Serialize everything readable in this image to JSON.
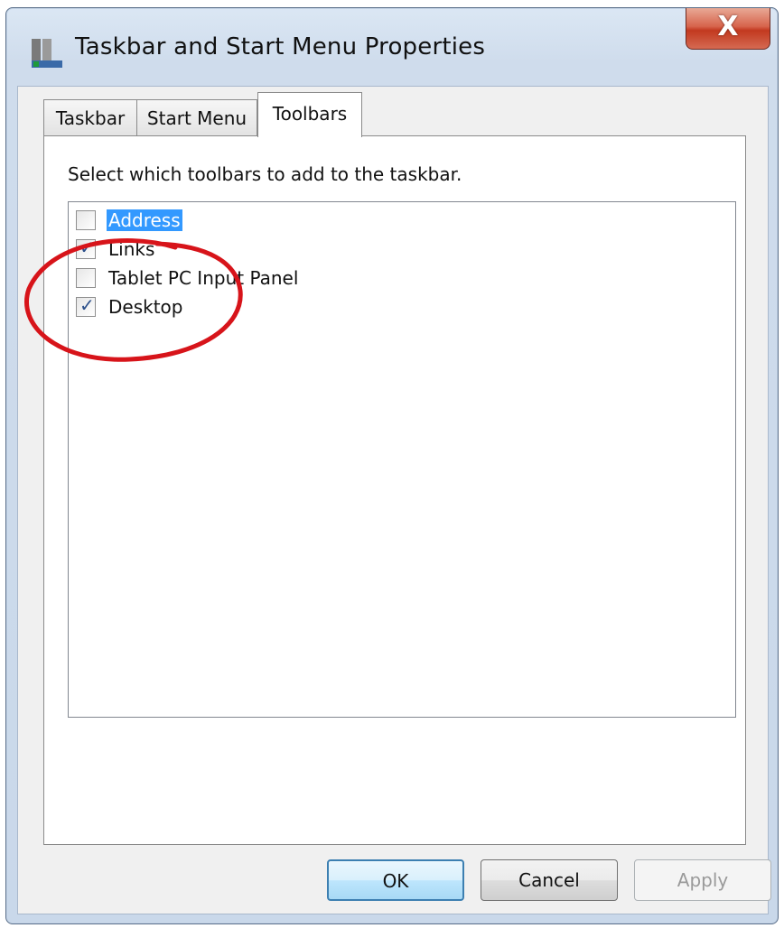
{
  "window": {
    "title": "Taskbar and Start Menu Properties",
    "close_glyph": "X",
    "icon": "taskbar-properties-icon"
  },
  "tabs": [
    {
      "label": "Taskbar",
      "selected": false
    },
    {
      "label": "Start Menu",
      "selected": false
    },
    {
      "label": "Toolbars",
      "selected": true
    }
  ],
  "content": {
    "instruction": "Select which toolbars to add to the taskbar.",
    "toolbars": [
      {
        "label": "Address",
        "checked": false,
        "highlighted": true
      },
      {
        "label": "Links",
        "checked": true,
        "highlighted": false
      },
      {
        "label": "Tablet PC Input Panel",
        "checked": false,
        "highlighted": false
      },
      {
        "label": "Desktop",
        "checked": true,
        "highlighted": false
      }
    ]
  },
  "buttons": {
    "ok": "OK",
    "cancel": "Cancel",
    "apply": "Apply"
  },
  "colors": {
    "selection": "#3399ff",
    "annotation": "#d7141a",
    "close": "#c2391f"
  }
}
